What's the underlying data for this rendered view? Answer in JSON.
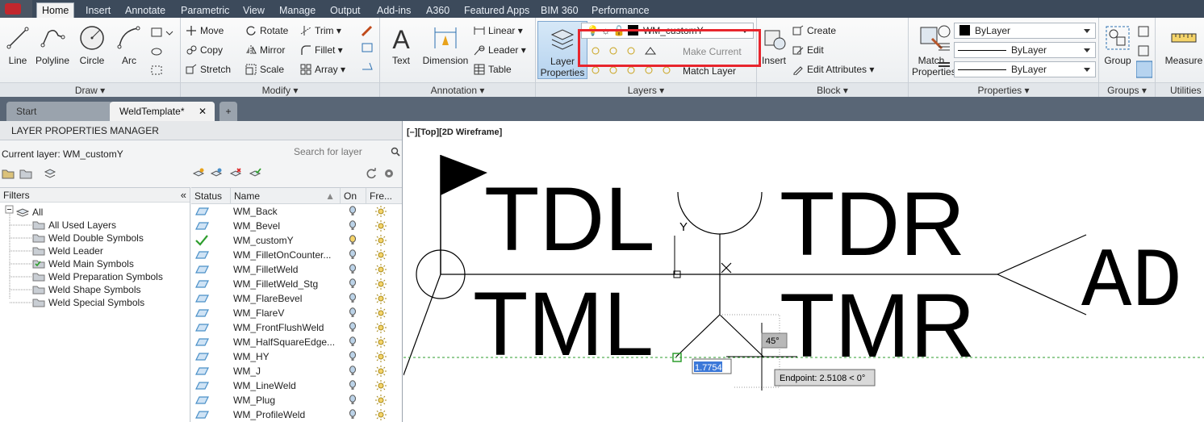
{
  "ribbon_tabs": [
    "Home",
    "Insert",
    "Annotate",
    "Parametric",
    "View",
    "Manage",
    "Output",
    "Add-ins",
    "A360",
    "Featured Apps",
    "BIM 360",
    "Performance"
  ],
  "active_tab": "Home",
  "draw": {
    "title": "Draw",
    "line": "Line",
    "polyline": "Polyline",
    "circle": "Circle",
    "arc": "Arc"
  },
  "modify": {
    "title": "Modify",
    "move": "Move",
    "rotate": "Rotate",
    "trim": "Trim",
    "copy": "Copy",
    "mirror": "Mirror",
    "fillet": "Fillet",
    "stretch": "Stretch",
    "scale": "Scale",
    "array": "Array"
  },
  "annotation": {
    "title": "Annotation",
    "text": "Text",
    "dimension": "Dimension",
    "linear": "Linear",
    "leader": "Leader",
    "table": "Table"
  },
  "layers": {
    "title": "Layers",
    "layer_properties": "Layer Properties",
    "current": "WM_customY",
    "make_current": "Make Current",
    "match_layer": "Match Layer"
  },
  "block": {
    "title": "Block",
    "insert": "Insert",
    "create": "Create",
    "edit": "Edit",
    "edit_attributes": "Edit Attributes"
  },
  "properties": {
    "title": "Properties",
    "match_properties": "Match Properties",
    "color": "ByLayer",
    "linetype": "ByLayer",
    "lineweight": "ByLayer"
  },
  "groups": {
    "title": "Groups",
    "group": "Group"
  },
  "utilities": {
    "title": "Utilities",
    "measure": "Measure"
  },
  "doc_tabs": {
    "start": "Start",
    "active": "WeldTemplate*",
    "close": "✕",
    "plus": "+"
  },
  "lpm": {
    "title": "LAYER PROPERTIES MANAGER",
    "current_layer": "Current layer: WM_customY",
    "search_placeholder": "Search for layer",
    "filters_title": "Filters",
    "collapse": "«",
    "tree_root": "All",
    "tree_items": [
      "All Used Layers",
      "Weld Double Symbols",
      "Weld Leader",
      "Weld Main Symbols",
      "Weld Preparation Symbols",
      "Weld Shape Symbols",
      "Weld Special Symbols"
    ],
    "columns": {
      "status": "Status",
      "name": "Name",
      "on": "On",
      "freeze": "Fre..."
    },
    "layers": [
      "WM_Back",
      "WM_Bevel",
      "WM_customY",
      "WM_FilletOnCounter...",
      "WM_FilletWeld",
      "WM_FilletWeld_Stg",
      "WM_FlareBevel",
      "WM_FlareV",
      "WM_FrontFlushWeld",
      "WM_HalfSquareEdge...",
      "WM_HY",
      "WM_J",
      "WM_LineWeld",
      "WM_Plug",
      "WM_ProfileWeld"
    ],
    "current_index": 2
  },
  "canvas": {
    "view_label": "[–][Top][2D Wireframe]",
    "tdl": "TDL",
    "tdr": "TDR",
    "tml": "TML",
    "tmr": "TMR",
    "ad": "AD",
    "y": "Y",
    "angle": "45°",
    "dim_input": "1.7754",
    "tooltip": "Endpoint: 2.5108 < 0°"
  },
  "colors": {
    "accent": "#e8252d",
    "ribbon_bar": "#3c4a5b",
    "layer_status": "#4a90c8",
    "current_check": "#2e9e2e"
  }
}
